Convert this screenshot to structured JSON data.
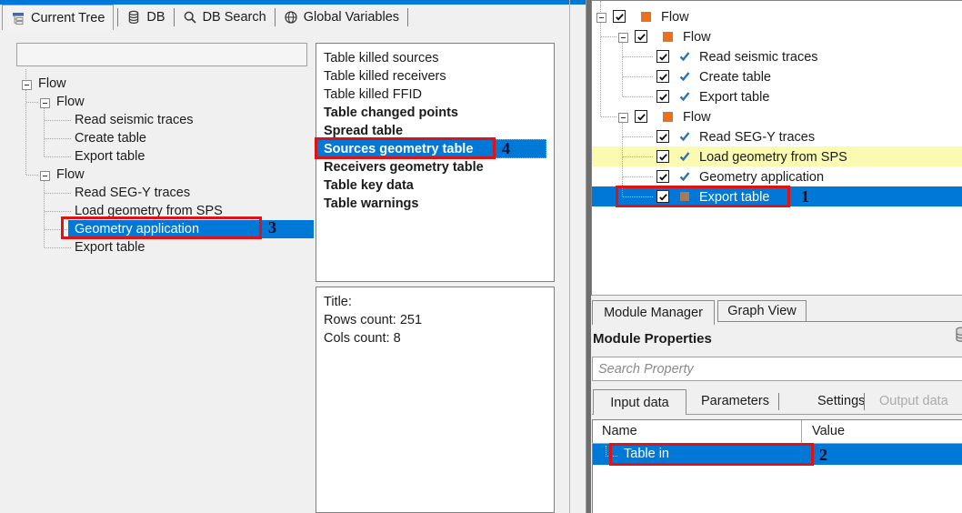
{
  "colors": {
    "selection_blue": "#0078d7",
    "highlight_yellow": "#fafab0",
    "flow_orange": "#e8701e",
    "muted_square_brown": "#a87a5c",
    "module_check_blue": "#2e74b5",
    "annotation_red": "#e01212"
  },
  "left_tabs": {
    "items": [
      {
        "label": "Current Tree",
        "icon": "tree-icon"
      },
      {
        "label": "DB",
        "icon": "database-icon"
      },
      {
        "label": "DB Search",
        "icon": "search-icon"
      },
      {
        "label": "Global Variables",
        "icon": "globe-icon"
      }
    ]
  },
  "left_panel": {
    "filter_input": {
      "value": "",
      "placeholder": ""
    },
    "tree": {
      "items": [
        {
          "label": "Flow",
          "depth": 0
        },
        {
          "label": "Flow",
          "depth": 1
        },
        {
          "label": "Read seismic traces",
          "depth": 2
        },
        {
          "label": "Create table",
          "depth": 2
        },
        {
          "label": "Export table",
          "depth": 2
        },
        {
          "label": "Flow",
          "depth": 1
        },
        {
          "label": "Read SEG-Y traces",
          "depth": 2
        },
        {
          "label": "Load geometry from SPS",
          "depth": 2
        },
        {
          "label": "Geometry application",
          "depth": 2,
          "selected": true
        },
        {
          "label": "Export table",
          "depth": 2
        }
      ]
    }
  },
  "tables_list": {
    "items": [
      {
        "label": "Table killed sources",
        "bold": false
      },
      {
        "label": "Table killed receivers",
        "bold": false
      },
      {
        "label": "Table killed FFID",
        "bold": false
      },
      {
        "label": "Table changed points",
        "bold": true
      },
      {
        "label": "Spread table",
        "bold": true
      },
      {
        "label": "Sources geometry table",
        "bold": true,
        "selected": true
      },
      {
        "label": "Receivers geometry table",
        "bold": true
      },
      {
        "label": "Table key data",
        "bold": true
      },
      {
        "label": "Table warnings",
        "bold": true
      }
    ]
  },
  "table_info": {
    "title": "Title:",
    "rows_count": "Rows count: 251",
    "cols_count": "Cols count: 8"
  },
  "right_tree": {
    "items": [
      {
        "label": "Flow",
        "depth": 0,
        "checked": true,
        "icon": "flow-square"
      },
      {
        "label": "Flow",
        "depth": 1,
        "checked": true,
        "icon": "flow-square"
      },
      {
        "label": "Read seismic traces",
        "depth": 2,
        "checked": true,
        "icon": "module-check"
      },
      {
        "label": "Create table",
        "depth": 2,
        "checked": true,
        "icon": "module-check"
      },
      {
        "label": "Export table",
        "depth": 2,
        "checked": true,
        "icon": "module-check"
      },
      {
        "label": "Flow",
        "depth": 1,
        "checked": true,
        "icon": "flow-square"
      },
      {
        "label": "Read SEG-Y traces",
        "depth": 2,
        "checked": true,
        "icon": "module-check"
      },
      {
        "label": "Load geometry from SPS",
        "depth": 2,
        "checked": true,
        "icon": "module-check",
        "highlighted": true
      },
      {
        "label": "Geometry application",
        "depth": 2,
        "checked": true,
        "icon": "module-check"
      },
      {
        "label": "Export table",
        "depth": 2,
        "checked": true,
        "icon": "flow-square-muted",
        "selected": true
      }
    ]
  },
  "bottom_tabs": {
    "module_manager": "Module Manager",
    "graph_view": "Graph View"
  },
  "module_properties": {
    "heading": "Module Properties",
    "search": {
      "value": "",
      "placeholder": "Search Property"
    },
    "tabs": [
      {
        "label": "Input data",
        "active": true
      },
      {
        "label": "Parameters"
      },
      {
        "label": "Settings"
      },
      {
        "label": "Output data",
        "disabled": true
      }
    ],
    "grid": {
      "columns": [
        {
          "label": "Name"
        },
        {
          "label": "Value"
        }
      ],
      "rows": [
        {
          "name": "Table in",
          "value": "",
          "selected": true
        }
      ]
    }
  },
  "annotations": {
    "step1": "1",
    "step2": "2",
    "step3": "3",
    "step4": "4"
  }
}
